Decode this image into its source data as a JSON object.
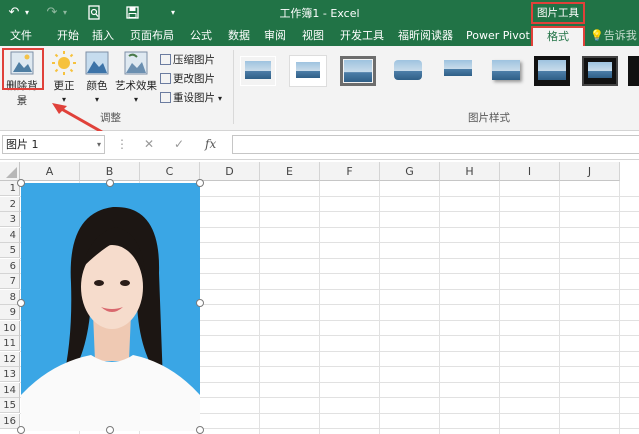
{
  "titlebar": {
    "title": "工作簿1 - Excel",
    "picture_tools": "图片工具"
  },
  "tabs": [
    {
      "label": "文件"
    },
    {
      "label": "开始"
    },
    {
      "label": "插入"
    },
    {
      "label": "页面布局"
    },
    {
      "label": "公式"
    },
    {
      "label": "数据"
    },
    {
      "label": "审阅"
    },
    {
      "label": "视图"
    },
    {
      "label": "开发工具"
    },
    {
      "label": "福昕阅读器"
    },
    {
      "label": "Power Pivot"
    },
    {
      "label": "格式"
    },
    {
      "label": "告诉我"
    }
  ],
  "ribbon": {
    "remove_bg": "删除背景",
    "corrections": "更正",
    "color": "颜色",
    "artistic": "艺术效果",
    "compress": "压缩图片",
    "change": "更改图片",
    "reset": "重设图片",
    "group_adjust": "调整",
    "group_styles": "图片样式"
  },
  "formula": {
    "namebox": "图片 1",
    "fx": "fx"
  },
  "columns": [
    "A",
    "B",
    "C",
    "D",
    "E",
    "F",
    "G",
    "H",
    "I",
    "J"
  ],
  "rows": [
    "1",
    "2",
    "3",
    "4",
    "5",
    "6",
    "7",
    "8",
    "9",
    "10",
    "11",
    "12",
    "13",
    "14",
    "15",
    "16"
  ],
  "colors": {
    "excel_green": "#217346",
    "highlight_red": "#e0413a",
    "photo_bg": "#3aa6e5"
  }
}
